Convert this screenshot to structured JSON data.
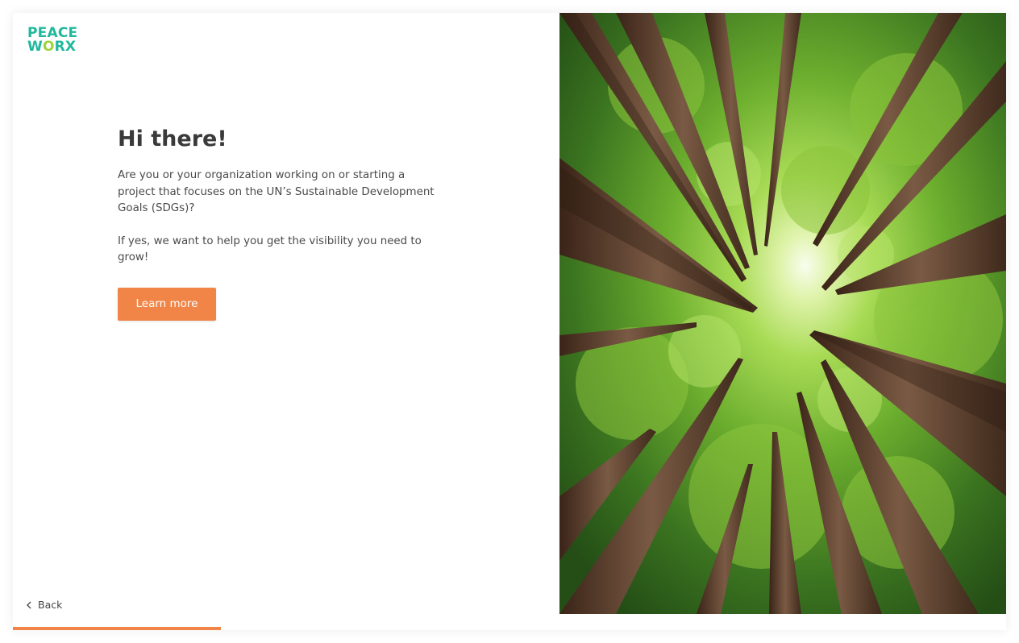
{
  "logo": {
    "line1": "PEACE",
    "line2_prefix": "W",
    "line2_o": "O",
    "line2_suffix": "RX",
    "colors": {
      "primary": "#1fb89c",
      "accent": "#9fd33a"
    }
  },
  "main": {
    "title": "Hi there!",
    "paragraph1": "Are you or your organization working on or starting a project that focuses on the UN’s Sustainable Development Goals (SDGs)?",
    "paragraph2": "If yes, we want to help you get the visibility you need to grow!",
    "cta_label": "Learn more"
  },
  "nav": {
    "back_label": "Back",
    "back_icon": "chevron-left-icon"
  },
  "progress": {
    "fraction": 0.38,
    "color": "#f18547"
  },
  "colors": {
    "button": "#f18547",
    "text": "#3a3a3a"
  }
}
